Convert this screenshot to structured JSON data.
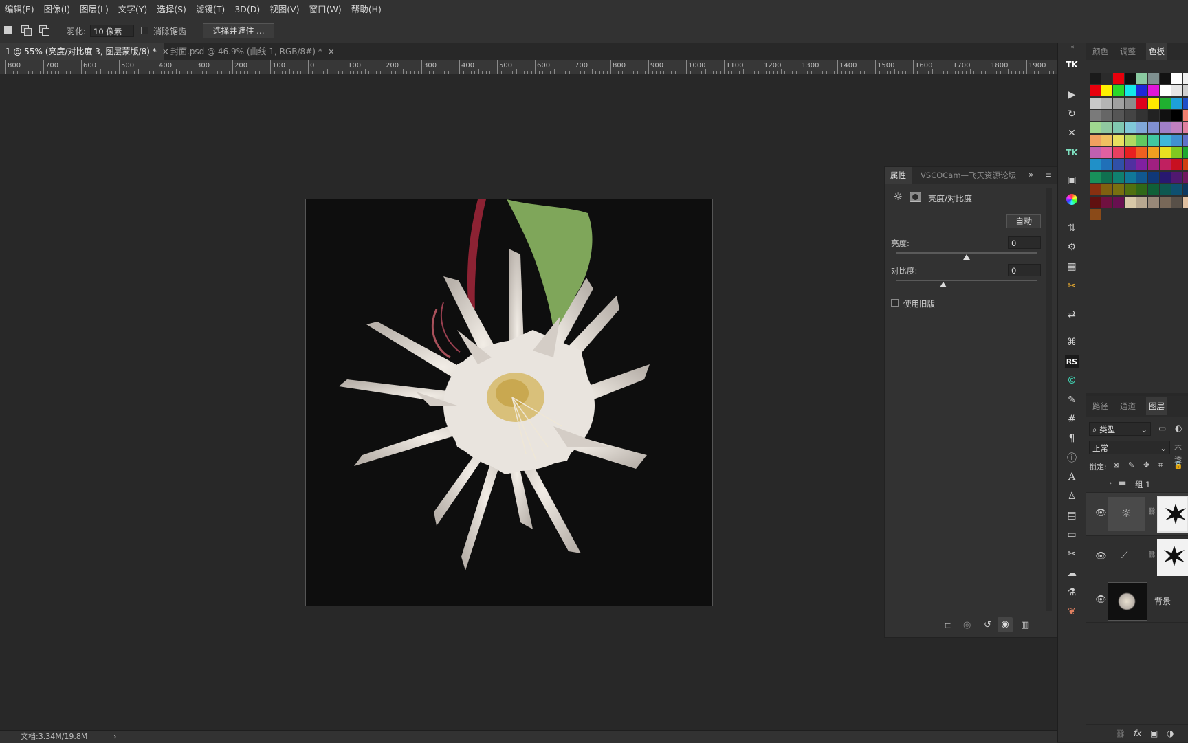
{
  "menu": [
    "编辑(E)",
    "图像(I)",
    "图层(L)",
    "文字(Y)",
    "选择(S)",
    "滤镜(T)",
    "3D(D)",
    "视图(V)",
    "窗口(W)",
    "帮助(H)"
  ],
  "options": {
    "feather_label": "羽化:",
    "feather_value": "10 像素",
    "antialias_label": "消除锯齿",
    "select_mask_button": "选择并遮住 ..."
  },
  "tabs": [
    {
      "label": "1 @ 55% (亮度/对比度 3, 图层蒙版/8) *",
      "close": "×"
    },
    {
      "label": "封面.psd @ 46.9% (曲线 1, RGB/8#) *",
      "close": "×"
    }
  ],
  "ruler": [
    "800",
    "700",
    "600",
    "500",
    "400",
    "300",
    "200",
    "100",
    "0",
    "100",
    "200",
    "300",
    "400",
    "500",
    "600",
    "700",
    "800",
    "900",
    "1000",
    "1100",
    "1200",
    "1300",
    "1400",
    "1500",
    "1600",
    "1700",
    "1800",
    "1900"
  ],
  "properties": {
    "tab_properties": "属性",
    "tab_vsco": "VSCOCam—飞天资源论坛",
    "title": "亮度/对比度",
    "auto_button": "自动",
    "brightness_label": "亮度:",
    "brightness_value": "0",
    "brightness_level": 0,
    "contrast_label": "对比度:",
    "contrast_value": "0",
    "contrast_level": 0,
    "legacy_label": "使用旧版"
  },
  "right_panel": {
    "tab_color": "颜色",
    "tab_adjust": "调整",
    "tab_swatches": "色板",
    "tab_paths": "路径",
    "tab_channels": "通道",
    "tab_layers": "图层",
    "filter_kind": "类型",
    "blend_mode": "正常",
    "opacity_label": "不透",
    "lock_label": "锁定:",
    "group_name": "组 1",
    "background_layer": "背景"
  },
  "toolstrip": [
    "TK",
    "RS"
  ],
  "status": {
    "doc_info": "文档:3.34M/19.8M",
    "arrow": "›"
  },
  "swatch_colors": [
    [
      "#1a1a1a",
      "#2b2b2b",
      "#e8000c",
      "#111111",
      "#8ac9a0",
      "#7f9090",
      "#121212",
      "#ffffff",
      "#f0f0f0"
    ],
    [
      "#e8000c",
      "#ffef00",
      "#2ad82a",
      "#14e8e8",
      "#1e28d8",
      "#e014d8",
      "#ffffff",
      "#e6e6e6",
      "#d0d0d0"
    ],
    [
      "#c8c8c8",
      "#b4b4b4",
      "#a0a0a0",
      "#8c8c8c",
      "#e0001c",
      "#ffe800",
      "#20b030",
      "#1ea0d8",
      "#2050c8"
    ],
    [
      "#7a7a7a",
      "#666666",
      "#555555",
      "#444444",
      "#333333",
      "#222222",
      "#111111",
      "#000000",
      "#f08070"
    ],
    [
      "#a0d890",
      "#90c8a0",
      "#80c8b0",
      "#80c8d8",
      "#80a8d8",
      "#8090d0",
      "#a080c8",
      "#c080c0",
      "#e080a0"
    ],
    [
      "#f0a060",
      "#f0c060",
      "#e8e060",
      "#b0d860",
      "#60c860",
      "#40c8a0",
      "#40b8d8",
      "#4090d0",
      "#6070c8"
    ],
    [
      "#c060b0",
      "#e060a0",
      "#e84060",
      "#e82020",
      "#f06020",
      "#f0a020",
      "#e8e020",
      "#80c820",
      "#20a830"
    ],
    [
      "#2090c8",
      "#2070b8",
      "#3050a8",
      "#5030a0",
      "#8020a0",
      "#a02080",
      "#c02060",
      "#c81020",
      "#d04010"
    ],
    [
      "#18905a",
      "#107050",
      "#108070",
      "#107898",
      "#105890",
      "#103878",
      "#281870",
      "#501870",
      "#701860"
    ],
    [
      "#883010",
      "#806010",
      "#787010",
      "#507010",
      "#306818",
      "#106038",
      "#0e5850",
      "#0e5070",
      "#0e3860"
    ],
    [
      "#601010",
      "#701040",
      "#681050",
      "#d8c8a8",
      "#b8a890",
      "#988878",
      "#786858",
      "#585048",
      "#e0c0a0"
    ],
    [
      "#8a4a18"
    ]
  ]
}
